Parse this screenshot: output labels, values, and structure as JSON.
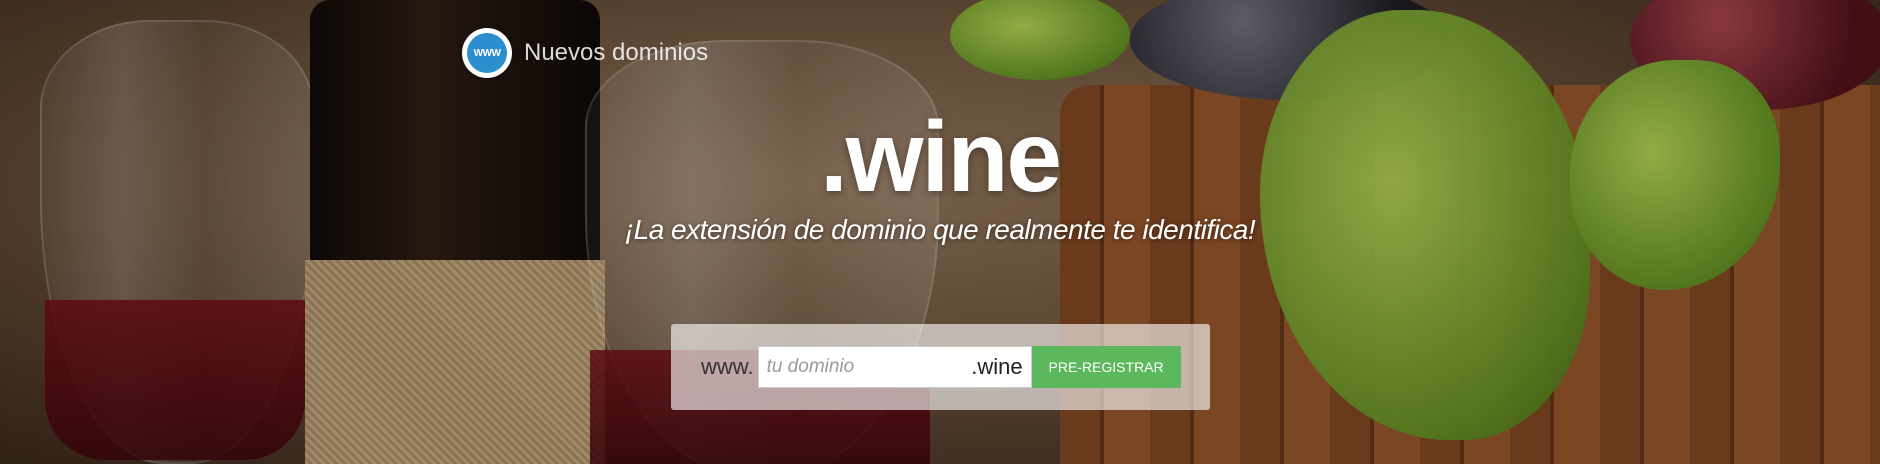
{
  "brand": {
    "icon": "www-globe-icon",
    "name": "Nuevos dominios"
  },
  "hero": {
    "title": ".wine",
    "subtitle": "¡La extensión de dominio que realmente te identifica!"
  },
  "search": {
    "prefix": "www.",
    "placeholder": "tu dominio",
    "value": "",
    "tld": ".wine",
    "button_label": "PRE-REGISTRAR"
  },
  "colors": {
    "button": "#5cb85c",
    "icon_bg": "#2b8fcf"
  }
}
